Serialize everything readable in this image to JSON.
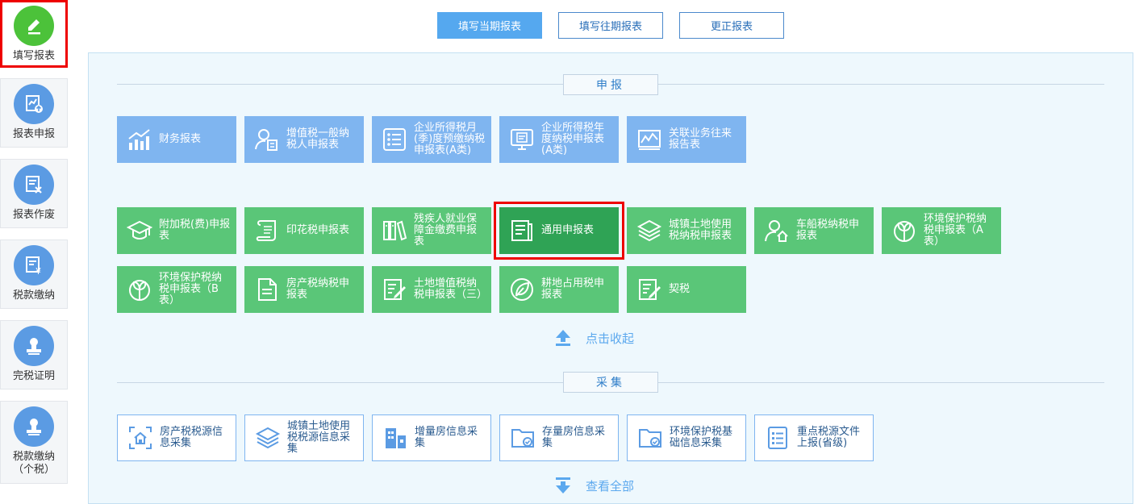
{
  "sidebar": {
    "items": [
      {
        "label": "填写报表"
      },
      {
        "label": "报表申报"
      },
      {
        "label": "报表作废"
      },
      {
        "label": "税款缴纳"
      },
      {
        "label": "完税证明"
      },
      {
        "label": "税款缴纳",
        "label2": "（个税）"
      }
    ]
  },
  "top_buttons": [
    "填写当期报表",
    "填写往期报表",
    "更正报表"
  ],
  "sections": {
    "declare": {
      "title": "申报",
      "row1": [
        {
          "label": "财务报表",
          "icon": "bar-chart-icon"
        },
        {
          "label": "增值税一般纳税人申报表",
          "icon": "user-doc-icon"
        },
        {
          "label": "企业所得税月(季)度预缴纳税申报表(A类)",
          "icon": "list-icon"
        },
        {
          "label": "企业所得税年度纳税申报表(A类)",
          "icon": "monitor-doc-icon"
        },
        {
          "label": "关联业务往来报告表",
          "icon": "line-chart-icon"
        }
      ],
      "row2": [
        {
          "label": "附加税(费)申报表",
          "icon": "graduation-cap-icon"
        },
        {
          "label": "印花税申报表",
          "icon": "scroll-icon"
        },
        {
          "label": "残疾人就业保障金缴费申报表",
          "icon": "books-icon"
        },
        {
          "label": "通用申报表",
          "icon": "document-icon"
        },
        {
          "label": "城镇土地使用税纳税申报表",
          "icon": "layers-icon"
        },
        {
          "label": "车船税纳税申报表",
          "icon": "user-home-icon"
        },
        {
          "label": "环境保护税纳税申报表（A表）",
          "icon": "eco-icon"
        }
      ],
      "row3": [
        {
          "label": "环境保护税纳税申报表（B表）",
          "icon": "eco-icon"
        },
        {
          "label": "房产税纳税申报表",
          "icon": "file-icon"
        },
        {
          "label": "土地增值税纳税申报表（三）",
          "icon": "edit-doc-icon"
        },
        {
          "label": "耕地占用税申报表",
          "icon": "leaf-icon"
        },
        {
          "label": "契税",
          "icon": "edit-doc-icon"
        }
      ],
      "collapse_label": "点击收起"
    },
    "collect": {
      "title": "采集",
      "items": [
        {
          "label": "房产税税源信息采集",
          "icon": "house-scan-icon"
        },
        {
          "label": "城镇土地使用税税源信息采集",
          "icon": "layers-icon"
        },
        {
          "label": "增量房信息采集",
          "icon": "building-icon"
        },
        {
          "label": "存量房信息采集",
          "icon": "folder-check-icon"
        },
        {
          "label": "环境保护税基础信息采集",
          "icon": "folder-check-icon"
        },
        {
          "label": "重点税源文件上报(省级)",
          "icon": "list-doc-icon"
        }
      ],
      "expand_label": "查看全部"
    }
  },
  "colors": {
    "blue_tile": "#7fb5f0",
    "green_tile": "#5ac678",
    "selected_tile": "#2fa355",
    "highlight": "#e00000"
  }
}
